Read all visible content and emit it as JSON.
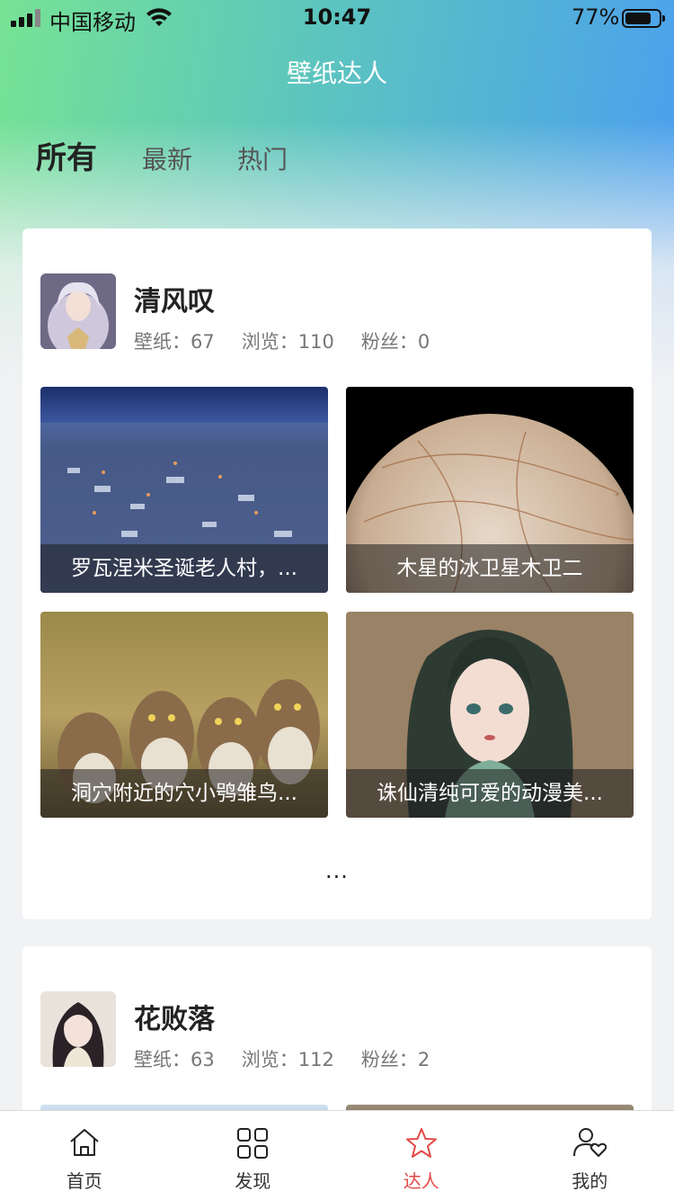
{
  "status_bar": {
    "carrier": "中国移动",
    "time": "10:47",
    "battery_percent": "77%",
    "battery_level": 0.77
  },
  "nav": {
    "title": "壁纸达人"
  },
  "tabs": [
    {
      "label": "所有",
      "active": true
    },
    {
      "label": "最新",
      "active": false
    },
    {
      "label": "热门",
      "active": false
    }
  ],
  "users": [
    {
      "name": "清风叹",
      "stats": {
        "wallpapers": "壁纸：67",
        "views": "浏览：110",
        "fans": "粉丝：0"
      },
      "wallpapers": [
        {
          "caption": "罗瓦涅米圣诞老人村，..."
        },
        {
          "caption": "木星的冰卫星木卫二"
        },
        {
          "caption": "洞穴附近的穴小鸮雏鸟..."
        },
        {
          "caption": "诛仙清纯可爱的动漫美..."
        }
      ],
      "more": "..."
    },
    {
      "name": "花败落",
      "stats": {
        "wallpapers": "壁纸：63",
        "views": "浏览：112",
        "fans": "粉丝：2"
      }
    }
  ],
  "tabbar": [
    {
      "label": "首页",
      "icon": "home-icon"
    },
    {
      "label": "发现",
      "icon": "grid-icon"
    },
    {
      "label": "达人",
      "icon": "star-icon",
      "active": true
    },
    {
      "label": "我的",
      "icon": "user-heart-icon"
    }
  ],
  "colors": {
    "accent": "#e24a46",
    "gradient_start": "#76e394",
    "gradient_end": "#4a9cf2"
  }
}
